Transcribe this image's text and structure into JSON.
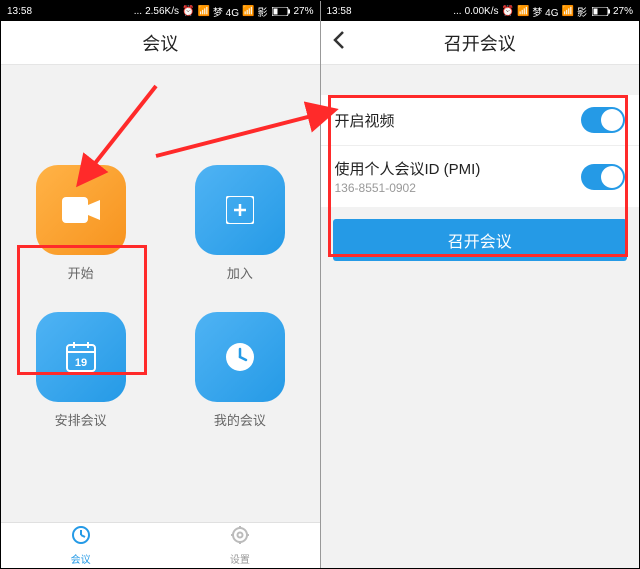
{
  "statusbar": {
    "left": {
      "time": "13:58",
      "speed": "2.56K/s",
      "carrier1": "梦 4G",
      "carrier2": "影",
      "battery_pct": "27%"
    },
    "right": {
      "time": "13:58",
      "speed": "0.00K/s",
      "carrier1": "梦 4G",
      "carrier2": "影",
      "battery_pct": "27%"
    }
  },
  "left_screen": {
    "header_title": "会议",
    "tiles": {
      "start": "开始",
      "join": "加入",
      "schedule": "安排会议",
      "my_meetings": "我的会议"
    },
    "nav": {
      "meetings": "会议",
      "settings": "设置"
    }
  },
  "right_screen": {
    "header_title": "召开会议",
    "rows": {
      "enable_video": "开启视频",
      "use_pmi": "使用个人会议ID (PMI)",
      "pmi_value": "136-8551-0902"
    },
    "button": "召开会议"
  }
}
